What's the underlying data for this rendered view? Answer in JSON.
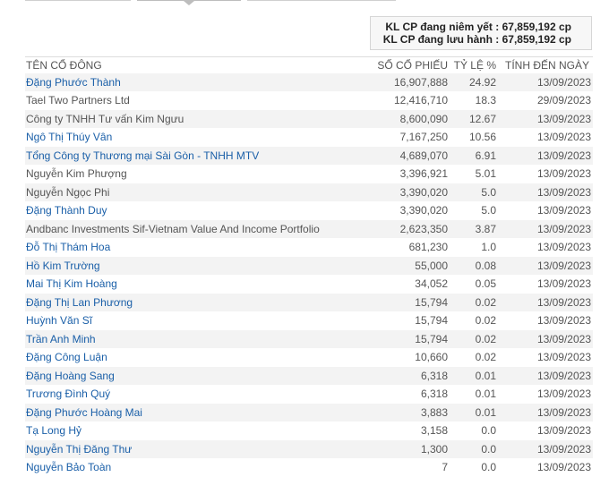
{
  "summary": {
    "listed": "KL CP đang niêm yết : 67,859,192 cp",
    "outstanding": "KL CP đang lưu hành : 67,859,192 cp"
  },
  "table": {
    "headers": {
      "name": "TÊN CỔ ĐÔNG",
      "shares": "SỐ CỔ PHIẾU",
      "percent": "TỶ LỆ %",
      "date": "TÍNH ĐẾN NGÀY"
    },
    "rows": [
      {
        "name": "Đặng Phước Thành",
        "shares": "16,907,888",
        "percent": "24.92",
        "date": "13/09/2023",
        "link": true
      },
      {
        "name": "Tael Two Partners Ltd",
        "shares": "12,416,710",
        "percent": "18.3",
        "date": "29/09/2023",
        "link": false
      },
      {
        "name": "Công ty TNHH Tư vấn Kim Ngưu",
        "shares": "8,600,090",
        "percent": "12.67",
        "date": "13/09/2023",
        "link": false
      },
      {
        "name": "Ngô Thị Thúy Vân",
        "shares": "7,167,250",
        "percent": "10.56",
        "date": "13/09/2023",
        "link": true
      },
      {
        "name": "Tổng Công ty Thương mại Sài Gòn - TNHH MTV",
        "shares": "4,689,070",
        "percent": "6.91",
        "date": "13/09/2023",
        "link": true
      },
      {
        "name": "Nguyễn Kim Phượng",
        "shares": "3,396,921",
        "percent": "5.01",
        "date": "13/09/2023",
        "link": false
      },
      {
        "name": "Nguyễn Ngọc Phi",
        "shares": "3,390,020",
        "percent": "5.0",
        "date": "13/09/2023",
        "link": false
      },
      {
        "name": "Đặng Thành Duy",
        "shares": "3,390,020",
        "percent": "5.0",
        "date": "13/09/2023",
        "link": true
      },
      {
        "name": "Andbanc Investments Sif-Vietnam Value And Income Portfolio",
        "shares": "2,623,350",
        "percent": "3.87",
        "date": "13/09/2023",
        "link": false
      },
      {
        "name": "Đỗ Thị Thám Hoa",
        "shares": "681,230",
        "percent": "1.0",
        "date": "13/09/2023",
        "link": true
      },
      {
        "name": "Hồ Kim Trường",
        "shares": "55,000",
        "percent": "0.08",
        "date": "13/09/2023",
        "link": true
      },
      {
        "name": "Mai Thị Kim Hoàng",
        "shares": "34,052",
        "percent": "0.05",
        "date": "13/09/2023",
        "link": true
      },
      {
        "name": "Đặng Thị Lan Phương",
        "shares": "15,794",
        "percent": "0.02",
        "date": "13/09/2023",
        "link": true
      },
      {
        "name": "Huỳnh Văn Sĩ",
        "shares": "15,794",
        "percent": "0.02",
        "date": "13/09/2023",
        "link": true
      },
      {
        "name": "Trần Anh Minh",
        "shares": "15,794",
        "percent": "0.02",
        "date": "13/09/2023",
        "link": true
      },
      {
        "name": "Đặng Công Luận",
        "shares": "10,660",
        "percent": "0.02",
        "date": "13/09/2023",
        "link": true
      },
      {
        "name": "Đặng Hoàng Sang",
        "shares": "6,318",
        "percent": "0.01",
        "date": "13/09/2023",
        "link": true
      },
      {
        "name": "Trương Đình Quý",
        "shares": "6,318",
        "percent": "0.01",
        "date": "13/09/2023",
        "link": true
      },
      {
        "name": "Đặng Phước Hoàng Mai",
        "shares": "3,883",
        "percent": "0.01",
        "date": "13/09/2023",
        "link": true
      },
      {
        "name": "Tạ Long Hỷ",
        "shares": "3,158",
        "percent": "0.0",
        "date": "13/09/2023",
        "link": true
      },
      {
        "name": "Nguyễn Thị Đăng Thư",
        "shares": "1,300",
        "percent": "0.0",
        "date": "13/09/2023",
        "link": true
      },
      {
        "name": "Nguyễn Bảo Toàn",
        "shares": "7",
        "percent": "0.0",
        "date": "13/09/2023",
        "link": true
      }
    ]
  },
  "colors": {
    "link": "#1a5fa8",
    "text": "#555555",
    "row_stripe": "#f3f3f3",
    "summary_bg": "#f7f7f7"
  }
}
